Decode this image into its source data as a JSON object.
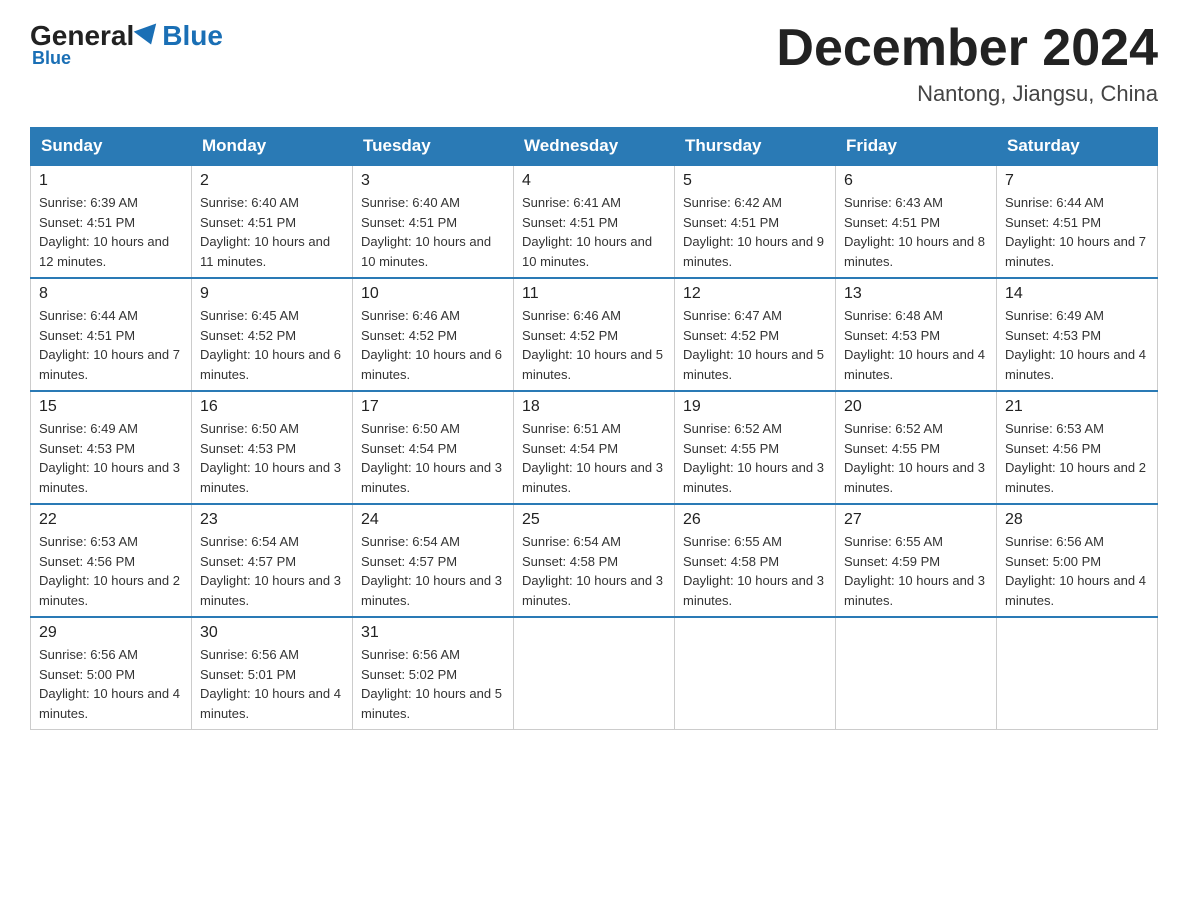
{
  "logo": {
    "general": "General",
    "blue": "Blue"
  },
  "header": {
    "month_year": "December 2024",
    "location": "Nantong, Jiangsu, China"
  },
  "days_of_week": [
    "Sunday",
    "Monday",
    "Tuesday",
    "Wednesday",
    "Thursday",
    "Friday",
    "Saturday"
  ],
  "weeks": [
    [
      {
        "day": "1",
        "sunrise": "Sunrise: 6:39 AM",
        "sunset": "Sunset: 4:51 PM",
        "daylight": "Daylight: 10 hours and 12 minutes."
      },
      {
        "day": "2",
        "sunrise": "Sunrise: 6:40 AM",
        "sunset": "Sunset: 4:51 PM",
        "daylight": "Daylight: 10 hours and 11 minutes."
      },
      {
        "day": "3",
        "sunrise": "Sunrise: 6:40 AM",
        "sunset": "Sunset: 4:51 PM",
        "daylight": "Daylight: 10 hours and 10 minutes."
      },
      {
        "day": "4",
        "sunrise": "Sunrise: 6:41 AM",
        "sunset": "Sunset: 4:51 PM",
        "daylight": "Daylight: 10 hours and 10 minutes."
      },
      {
        "day": "5",
        "sunrise": "Sunrise: 6:42 AM",
        "sunset": "Sunset: 4:51 PM",
        "daylight": "Daylight: 10 hours and 9 minutes."
      },
      {
        "day": "6",
        "sunrise": "Sunrise: 6:43 AM",
        "sunset": "Sunset: 4:51 PM",
        "daylight": "Daylight: 10 hours and 8 minutes."
      },
      {
        "day": "7",
        "sunrise": "Sunrise: 6:44 AM",
        "sunset": "Sunset: 4:51 PM",
        "daylight": "Daylight: 10 hours and 7 minutes."
      }
    ],
    [
      {
        "day": "8",
        "sunrise": "Sunrise: 6:44 AM",
        "sunset": "Sunset: 4:51 PM",
        "daylight": "Daylight: 10 hours and 7 minutes."
      },
      {
        "day": "9",
        "sunrise": "Sunrise: 6:45 AM",
        "sunset": "Sunset: 4:52 PM",
        "daylight": "Daylight: 10 hours and 6 minutes."
      },
      {
        "day": "10",
        "sunrise": "Sunrise: 6:46 AM",
        "sunset": "Sunset: 4:52 PM",
        "daylight": "Daylight: 10 hours and 6 minutes."
      },
      {
        "day": "11",
        "sunrise": "Sunrise: 6:46 AM",
        "sunset": "Sunset: 4:52 PM",
        "daylight": "Daylight: 10 hours and 5 minutes."
      },
      {
        "day": "12",
        "sunrise": "Sunrise: 6:47 AM",
        "sunset": "Sunset: 4:52 PM",
        "daylight": "Daylight: 10 hours and 5 minutes."
      },
      {
        "day": "13",
        "sunrise": "Sunrise: 6:48 AM",
        "sunset": "Sunset: 4:53 PM",
        "daylight": "Daylight: 10 hours and 4 minutes."
      },
      {
        "day": "14",
        "sunrise": "Sunrise: 6:49 AM",
        "sunset": "Sunset: 4:53 PM",
        "daylight": "Daylight: 10 hours and 4 minutes."
      }
    ],
    [
      {
        "day": "15",
        "sunrise": "Sunrise: 6:49 AM",
        "sunset": "Sunset: 4:53 PM",
        "daylight": "Daylight: 10 hours and 3 minutes."
      },
      {
        "day": "16",
        "sunrise": "Sunrise: 6:50 AM",
        "sunset": "Sunset: 4:53 PM",
        "daylight": "Daylight: 10 hours and 3 minutes."
      },
      {
        "day": "17",
        "sunrise": "Sunrise: 6:50 AM",
        "sunset": "Sunset: 4:54 PM",
        "daylight": "Daylight: 10 hours and 3 minutes."
      },
      {
        "day": "18",
        "sunrise": "Sunrise: 6:51 AM",
        "sunset": "Sunset: 4:54 PM",
        "daylight": "Daylight: 10 hours and 3 minutes."
      },
      {
        "day": "19",
        "sunrise": "Sunrise: 6:52 AM",
        "sunset": "Sunset: 4:55 PM",
        "daylight": "Daylight: 10 hours and 3 minutes."
      },
      {
        "day": "20",
        "sunrise": "Sunrise: 6:52 AM",
        "sunset": "Sunset: 4:55 PM",
        "daylight": "Daylight: 10 hours and 3 minutes."
      },
      {
        "day": "21",
        "sunrise": "Sunrise: 6:53 AM",
        "sunset": "Sunset: 4:56 PM",
        "daylight": "Daylight: 10 hours and 2 minutes."
      }
    ],
    [
      {
        "day": "22",
        "sunrise": "Sunrise: 6:53 AM",
        "sunset": "Sunset: 4:56 PM",
        "daylight": "Daylight: 10 hours and 2 minutes."
      },
      {
        "day": "23",
        "sunrise": "Sunrise: 6:54 AM",
        "sunset": "Sunset: 4:57 PM",
        "daylight": "Daylight: 10 hours and 3 minutes."
      },
      {
        "day": "24",
        "sunrise": "Sunrise: 6:54 AM",
        "sunset": "Sunset: 4:57 PM",
        "daylight": "Daylight: 10 hours and 3 minutes."
      },
      {
        "day": "25",
        "sunrise": "Sunrise: 6:54 AM",
        "sunset": "Sunset: 4:58 PM",
        "daylight": "Daylight: 10 hours and 3 minutes."
      },
      {
        "day": "26",
        "sunrise": "Sunrise: 6:55 AM",
        "sunset": "Sunset: 4:58 PM",
        "daylight": "Daylight: 10 hours and 3 minutes."
      },
      {
        "day": "27",
        "sunrise": "Sunrise: 6:55 AM",
        "sunset": "Sunset: 4:59 PM",
        "daylight": "Daylight: 10 hours and 3 minutes."
      },
      {
        "day": "28",
        "sunrise": "Sunrise: 6:56 AM",
        "sunset": "Sunset: 5:00 PM",
        "daylight": "Daylight: 10 hours and 4 minutes."
      }
    ],
    [
      {
        "day": "29",
        "sunrise": "Sunrise: 6:56 AM",
        "sunset": "Sunset: 5:00 PM",
        "daylight": "Daylight: 10 hours and 4 minutes."
      },
      {
        "day": "30",
        "sunrise": "Sunrise: 6:56 AM",
        "sunset": "Sunset: 5:01 PM",
        "daylight": "Daylight: 10 hours and 4 minutes."
      },
      {
        "day": "31",
        "sunrise": "Sunrise: 6:56 AM",
        "sunset": "Sunset: 5:02 PM",
        "daylight": "Daylight: 10 hours and 5 minutes."
      },
      null,
      null,
      null,
      null
    ]
  ]
}
